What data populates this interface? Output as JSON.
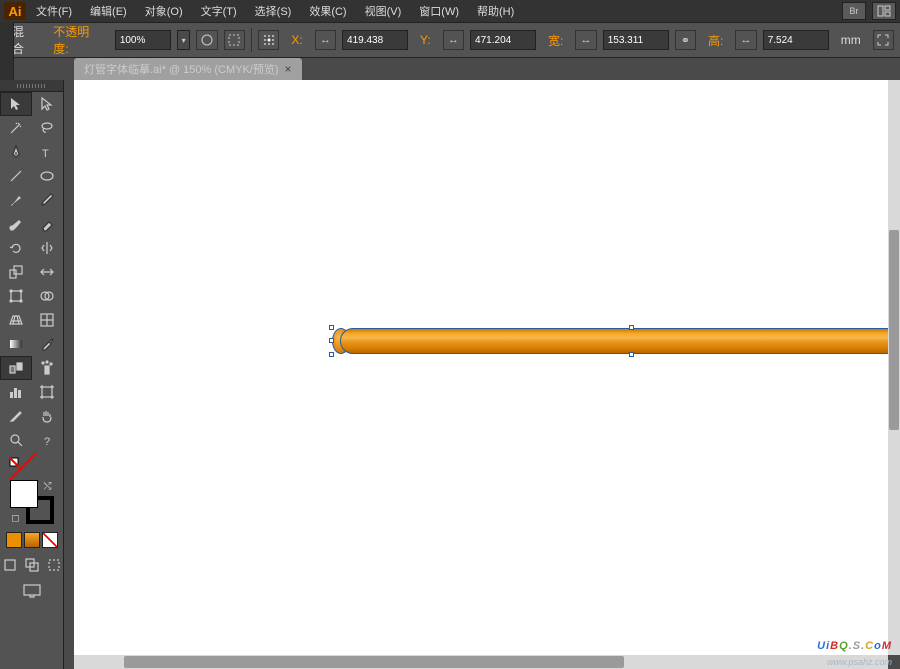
{
  "app": {
    "logo": "Ai"
  },
  "menu": {
    "file": "文件(F)",
    "edit": "编辑(E)",
    "object": "对象(O)",
    "type": "文字(T)",
    "select": "选择(S)",
    "effect": "效果(C)",
    "view": "视图(V)",
    "window": "窗口(W)",
    "help": "帮助(H)",
    "br": "Br"
  },
  "options": {
    "mode": "混合",
    "opacity_label": "不透明度:",
    "opacity_value": "100%",
    "x_label": "X:",
    "x_value": "419.438",
    "y_label": "Y:",
    "y_value": "471.204",
    "w_label": "宽:",
    "w_value": "153.311",
    "h_label": "高:",
    "h_value": "7.524",
    "unit": "mm",
    "link_icon": "⚭"
  },
  "tab": {
    "title": "灯管字体临摹.ai* @ 150% (CMYK/预览)",
    "close": "×"
  },
  "swatches": {
    "c1": "#e89000",
    "c2": "#f5a623",
    "c3": "#ffffff"
  },
  "watermark": {
    "text": "UiBQ.S.CoM",
    "sub": "www.psahz.com"
  }
}
